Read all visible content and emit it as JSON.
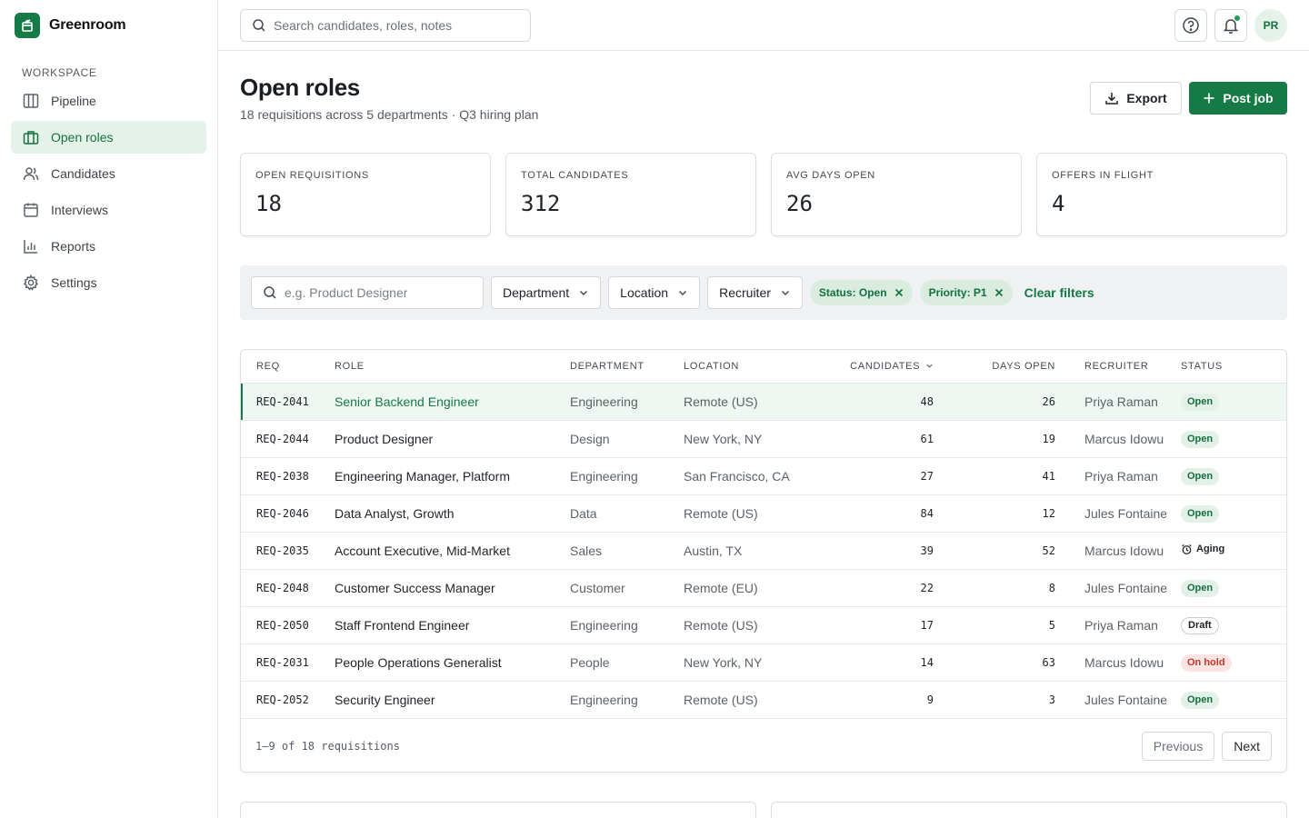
{
  "app": {
    "name": "Greenroom"
  },
  "sidebar": {
    "section_label": "WORKSPACE",
    "items": [
      {
        "label": "Pipeline",
        "icon": "columns-icon"
      },
      {
        "label": "Open roles",
        "icon": "briefcase-icon",
        "active": true
      },
      {
        "label": "Candidates",
        "icon": "users-icon"
      },
      {
        "label": "Interviews",
        "icon": "calendar-icon"
      },
      {
        "label": "Reports",
        "icon": "bar-chart-icon"
      },
      {
        "label": "Settings",
        "icon": "gear-icon"
      }
    ]
  },
  "topbar": {
    "search_placeholder": "Search candidates, roles, notes",
    "avatar_initials": "PR"
  },
  "page": {
    "title": "Open roles",
    "subtitle": "18 requisitions across 5 departments · Q3 hiring plan",
    "export_label": "Export",
    "post_label": "Post job"
  },
  "stats": [
    {
      "label": "OPEN REQUISITIONS",
      "value": "18"
    },
    {
      "label": "TOTAL CANDIDATES",
      "value": "312"
    },
    {
      "label": "AVG DAYS OPEN",
      "value": "26"
    },
    {
      "label": "OFFERS IN FLIGHT",
      "value": "4"
    }
  ],
  "filters": {
    "search_placeholder": "e.g. Product Designer",
    "dropdowns": [
      "Department",
      "Location",
      "Recruiter"
    ],
    "chips": [
      "Status: Open",
      "Priority: P1"
    ],
    "clear_label": "Clear filters"
  },
  "table": {
    "columns": {
      "req": "REQ",
      "role": "ROLE",
      "department": "DEPARTMENT",
      "location": "LOCATION",
      "candidates": "CANDIDATES",
      "days_open": "DAYS OPEN",
      "recruiter": "RECRUITER",
      "status": "STATUS"
    },
    "sorted_by": "candidates",
    "rows": [
      {
        "req": "REQ-2041",
        "role": "Senior Backend Engineer",
        "department": "Engineering",
        "location": "Remote (US)",
        "candidates": "48",
        "days_open": "26",
        "recruiter": "Priya Raman",
        "status": "Open",
        "selected": true
      },
      {
        "req": "REQ-2044",
        "role": "Product Designer",
        "department": "Design",
        "location": "New York, NY",
        "candidates": "61",
        "days_open": "19",
        "recruiter": "Marcus Idowu",
        "status": "Open"
      },
      {
        "req": "REQ-2038",
        "role": "Engineering Manager, Platform",
        "department": "Engineering",
        "location": "San Francisco, CA",
        "candidates": "27",
        "days_open": "41",
        "recruiter": "Priya Raman",
        "status": "Open"
      },
      {
        "req": "REQ-2046",
        "role": "Data Analyst, Growth",
        "department": "Data",
        "location": "Remote (US)",
        "candidates": "84",
        "days_open": "12",
        "recruiter": "Jules Fontaine",
        "status": "Open"
      },
      {
        "req": "REQ-2035",
        "role": "Account Executive, Mid-Market",
        "department": "Sales",
        "location": "Austin, TX",
        "candidates": "39",
        "days_open": "52",
        "recruiter": "Marcus Idowu",
        "status": "Aging"
      },
      {
        "req": "REQ-2048",
        "role": "Customer Success Manager",
        "department": "Customer",
        "location": "Remote (EU)",
        "candidates": "22",
        "days_open": "8",
        "recruiter": "Jules Fontaine",
        "status": "Open"
      },
      {
        "req": "REQ-2050",
        "role": "Staff Frontend Engineer",
        "department": "Engineering",
        "location": "Remote (US)",
        "candidates": "17",
        "days_open": "5",
        "recruiter": "Priya Raman",
        "status": "Draft"
      },
      {
        "req": "REQ-2031",
        "role": "People Operations Generalist",
        "department": "People",
        "location": "New York, NY",
        "candidates": "14",
        "days_open": "63",
        "recruiter": "Marcus Idowu",
        "status": "On hold"
      },
      {
        "req": "REQ-2052",
        "role": "Security Engineer",
        "department": "Engineering",
        "location": "Remote (US)",
        "candidates": "9",
        "days_open": "3",
        "recruiter": "Jules Fontaine",
        "status": "Open"
      }
    ],
    "footer_count": "1–9 of 18 requisitions",
    "prev_label": "Previous",
    "next_label": "Next"
  },
  "colors": {
    "accent": "#167a46",
    "accent_light": "#e5f2ea",
    "status_open_bg": "#e3f1e8",
    "status_hold_bg": "#fbe4e2",
    "status_hold_text": "#c4382c"
  }
}
